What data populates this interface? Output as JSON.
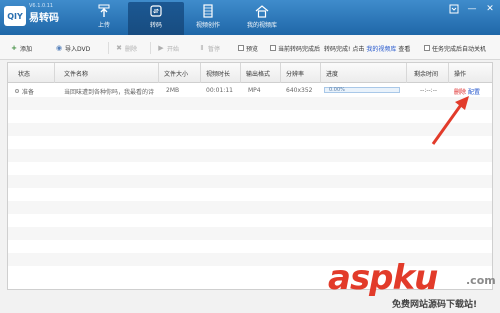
{
  "app": {
    "brand": "易转码",
    "logo_text": "QIY",
    "version": "V6.1.0.11"
  },
  "nav": [
    {
      "label": "上传",
      "icon": "upload-icon"
    },
    {
      "label": "转码",
      "icon": "convert-icon"
    },
    {
      "label": "视频创作",
      "icon": "film-icon"
    },
    {
      "label": "我的视频库",
      "icon": "home-icon"
    }
  ],
  "window": {
    "menu": "menu-icon",
    "minimize": "—",
    "close": "✕"
  },
  "toolbar": {
    "add": "添加",
    "import_dvd": "导入DVD",
    "delete": "删除",
    "start": "开始",
    "pause": "暂停",
    "preview": "预览",
    "when_done": "当前转码完成后",
    "after_done": "转码完成! 点击",
    "my_library": "我的视频库",
    "view": "查看",
    "shutdown": "任务完成后自动关机"
  },
  "table": {
    "columns": [
      "状态",
      "文件名称",
      "文件大小",
      "视频时长",
      "输出格式",
      "分辨率",
      "进度",
      "剩余时间",
      "操作"
    ],
    "rows": [
      {
        "status": "准备",
        "filename": "当回味遭到各种你吗，我最看的诗",
        "size": "2MB",
        "duration": "00:01:11",
        "format": "MP4",
        "resolution": "640x352",
        "progress_text": "0.00%",
        "progress": 0.0,
        "remaining": "--:--:--",
        "action_delete": "删除",
        "action_config": "配置"
      }
    ]
  },
  "watermark": {
    "main": "aspku",
    "suffix": ".com",
    "sub": "免费网站源码下载站!"
  },
  "colors": {
    "title_bar": "#2a73b5",
    "annotation": "#e23b2a",
    "link": "#2255cc"
  }
}
